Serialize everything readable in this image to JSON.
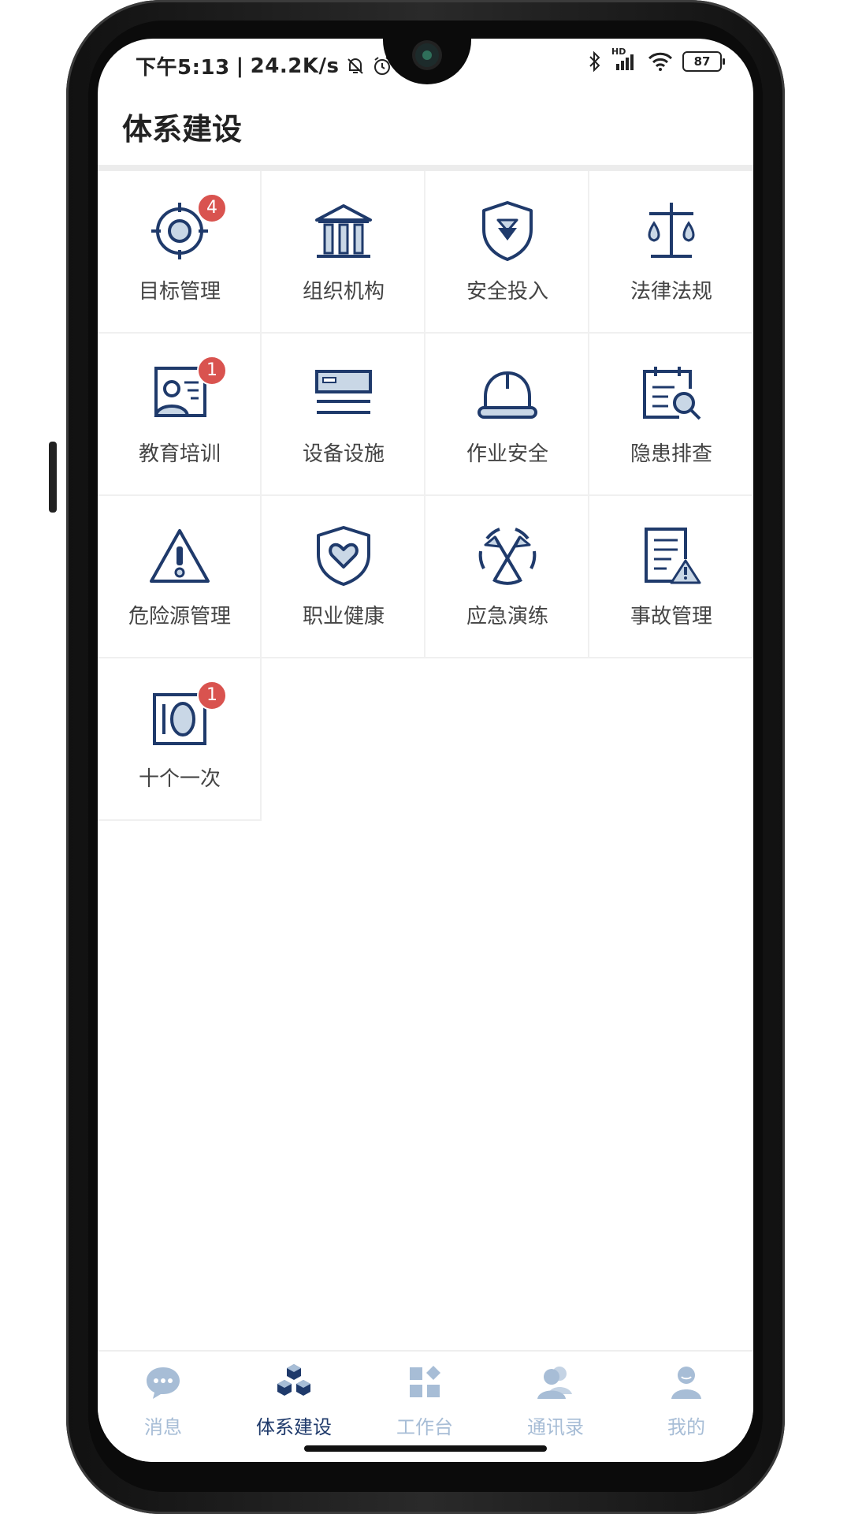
{
  "status_bar": {
    "time": "下午5:13",
    "network_speed": "24.2K/s",
    "battery": "87",
    "hd_label": "HD"
  },
  "header": {
    "title": "体系建设"
  },
  "modules": [
    {
      "label": "目标管理",
      "icon": "target-icon",
      "badge": "4"
    },
    {
      "label": "组织机构",
      "icon": "building-icon",
      "badge": ""
    },
    {
      "label": "安全投入",
      "icon": "shield-arrow-icon",
      "badge": ""
    },
    {
      "label": "法律法规",
      "icon": "scales-icon",
      "badge": ""
    },
    {
      "label": "教育培训",
      "icon": "training-icon",
      "badge": "1"
    },
    {
      "label": "设备设施",
      "icon": "equipment-icon",
      "badge": ""
    },
    {
      "label": "作业安全",
      "icon": "helmet-icon",
      "badge": ""
    },
    {
      "label": "隐患排查",
      "icon": "inspection-icon",
      "badge": ""
    },
    {
      "label": "危险源管理",
      "icon": "warning-icon",
      "badge": ""
    },
    {
      "label": "职业健康",
      "icon": "health-shield-icon",
      "badge": ""
    },
    {
      "label": "应急演练",
      "icon": "flags-icon",
      "badge": ""
    },
    {
      "label": "事故管理",
      "icon": "accident-report-icon",
      "badge": ""
    },
    {
      "label": "十个一次",
      "icon": "oval-frame-icon",
      "badge": "1"
    }
  ],
  "tab_bar": {
    "tabs": [
      {
        "label": "消息",
        "icon": "chat-bubble-icon",
        "active": false
      },
      {
        "label": "体系建设",
        "icon": "cubes-icon",
        "active": true
      },
      {
        "label": "工作台",
        "icon": "workbench-icon",
        "active": false
      },
      {
        "label": "通讯录",
        "icon": "contacts-icon",
        "active": false
      },
      {
        "label": "我的",
        "icon": "profile-icon",
        "active": false
      }
    ]
  },
  "colors": {
    "icon_stroke": "#1f3a6b",
    "icon_fill": "#c9d7e6",
    "badge": "#d9534f",
    "tab_inactive": "#a7bdd6",
    "tab_active": "#1f3a6b"
  }
}
